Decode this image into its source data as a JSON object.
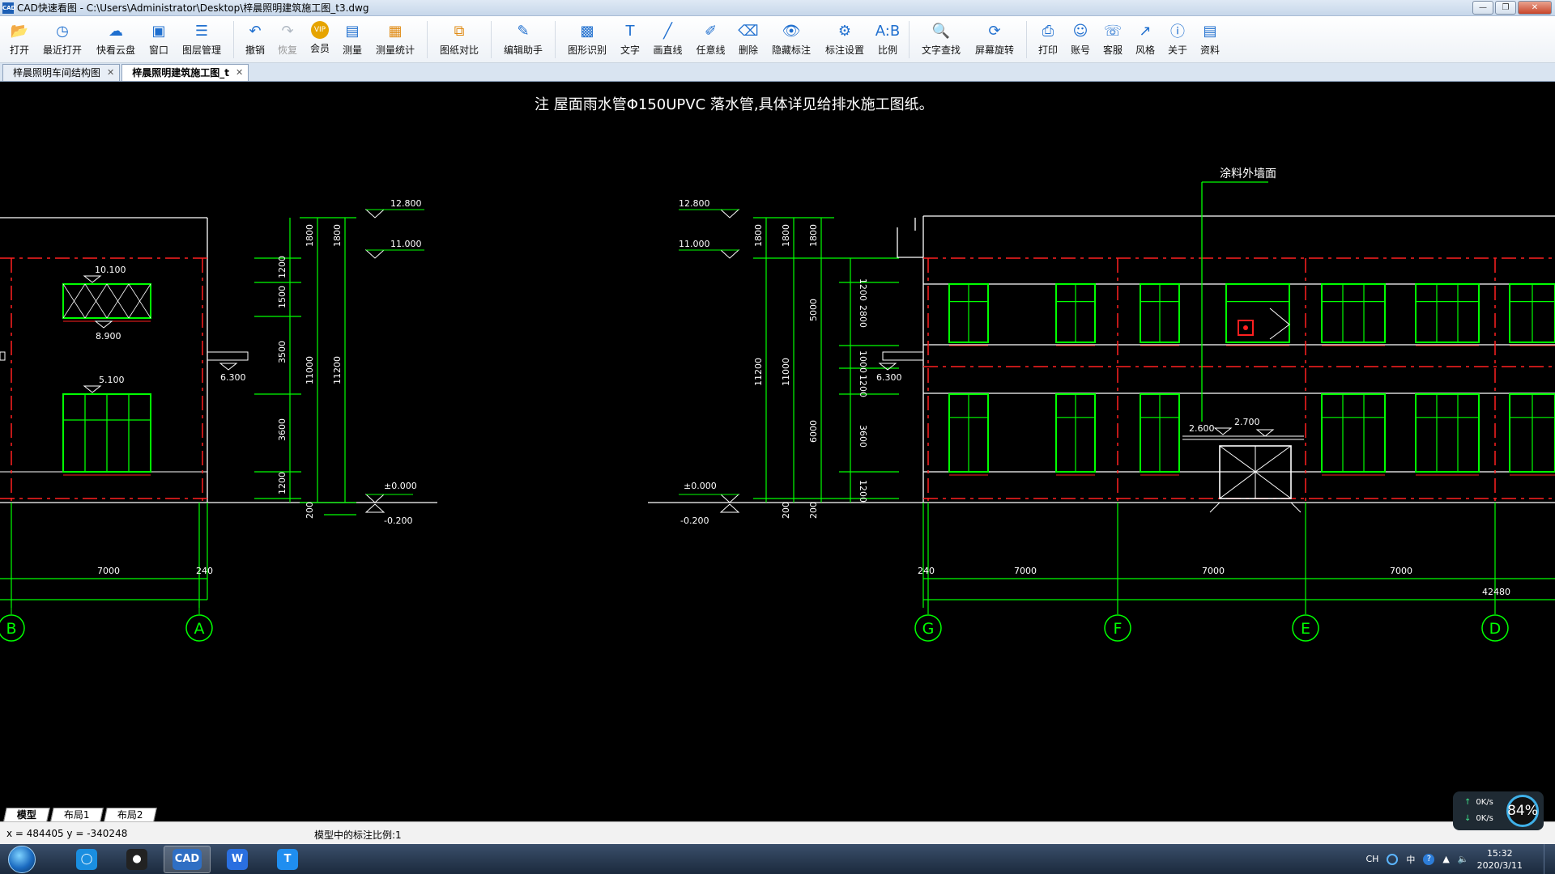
{
  "window": {
    "title": "CAD快速看图 - C:\\Users\\Administrator\\Desktop\\梓晨照明建筑施工图_t3.dwg",
    "badge": "CAD"
  },
  "toolbar": {
    "items": [
      {
        "label": "打开",
        "icon": "folder-icon"
      },
      {
        "label": "最近打开",
        "icon": "recent-icon"
      },
      {
        "label": "快看云盘",
        "icon": "cloud-icon"
      },
      {
        "label": "窗口",
        "icon": "window-icon"
      },
      {
        "label": "图层管理",
        "icon": "layers-icon"
      },
      {
        "label": "撤销",
        "icon": "undo-icon"
      },
      {
        "label": "恢复",
        "icon": "redo-icon"
      },
      {
        "label": "会员",
        "icon": "vip-icon"
      },
      {
        "label": "测量",
        "icon": "measure-icon"
      },
      {
        "label": "测量统计",
        "icon": "measure-stats-icon"
      },
      {
        "label": "图纸对比",
        "icon": "compare-icon"
      },
      {
        "label": "编辑助手",
        "icon": "edit-assistant-icon"
      },
      {
        "label": "图形识别",
        "icon": "shape-recognition-icon"
      },
      {
        "label": "文字",
        "icon": "text-icon"
      },
      {
        "label": "画直线",
        "icon": "line-icon"
      },
      {
        "label": "任意线",
        "icon": "freehand-icon"
      },
      {
        "label": "删除",
        "icon": "eraser-icon"
      },
      {
        "label": "隐藏标注",
        "icon": "hide-annotation-icon"
      },
      {
        "label": "标注设置",
        "icon": "annotation-settings-icon"
      },
      {
        "label": "比例",
        "icon": "scale-icon"
      },
      {
        "label": "文字查找",
        "icon": "text-search-icon"
      },
      {
        "label": "屏幕旋转",
        "icon": "rotate-screen-icon"
      },
      {
        "label": "打印",
        "icon": "print-icon"
      },
      {
        "label": "账号",
        "icon": "account-icon"
      },
      {
        "label": "客服",
        "icon": "headset-icon"
      },
      {
        "label": "风格",
        "icon": "style-icon"
      },
      {
        "label": "关于",
        "icon": "info-icon"
      },
      {
        "label": "资料",
        "icon": "resources-icon"
      }
    ]
  },
  "tabs": [
    {
      "label": "梓晨照明车间结构图",
      "active": false
    },
    {
      "label": "梓晨照明建筑施工图_t",
      "active": true
    }
  ],
  "drawing": {
    "note": "注 屋面雨水管Φ150UPVC 落水管,具体详见给排水施工图纸。",
    "callout": "涂料外墙面",
    "elevations_left": [
      "12.800",
      "11.000",
      "6.300",
      "±0.000",
      "-0.200"
    ],
    "elevations_right": [
      "12.800",
      "11.000",
      "±0.000",
      "-0.200",
      "6.300"
    ],
    "window_levels": [
      "10.100",
      "8.900",
      "5.100"
    ],
    "door_levels": [
      "2.600",
      "2.700"
    ],
    "dims_left_a": [
      "1200",
      "1500",
      "3500",
      "3600",
      "1200"
    ],
    "dims_left_b": [
      "1800",
      "1800"
    ],
    "dims_left_total": [
      "11000",
      "11200",
      "200"
    ],
    "dims_right_a": [
      "1200",
      "2800",
      "1000",
      "1200",
      "3600",
      "1200"
    ],
    "dims_right_b": [
      "1800",
      "1800",
      "1800",
      "5000",
      "6000",
      "200",
      "200"
    ],
    "dims_right_total": [
      "11200",
      "11000"
    ],
    "bay_dims_left": [
      "7000",
      "240"
    ],
    "bay_dims_right": [
      "240",
      "7000",
      "7000",
      "7000"
    ],
    "total_length": "42480",
    "axes_left": [
      "B",
      "A"
    ],
    "axes_right": [
      "G",
      "F",
      "E",
      "D"
    ],
    "colors": {
      "green": "#00ff00",
      "red": "#ff2020",
      "white": "#ffffff"
    }
  },
  "layout_tabs": [
    "模型",
    "布局1",
    "布局2"
  ],
  "status": {
    "coords": "x = 484405  y = -340248",
    "scale_note": "模型中的标注比例:1"
  },
  "speed": {
    "up": "0K/s",
    "down": "0K/s",
    "percent": "84%"
  },
  "taskbar": {
    "apps": [
      "browser-icon",
      "qq-icon",
      "cad-icon",
      "wps-icon",
      "text-app-icon"
    ],
    "tray_lang": "CH",
    "tray_ime": "中",
    "time": "15:32",
    "date": "2020/3/11"
  }
}
